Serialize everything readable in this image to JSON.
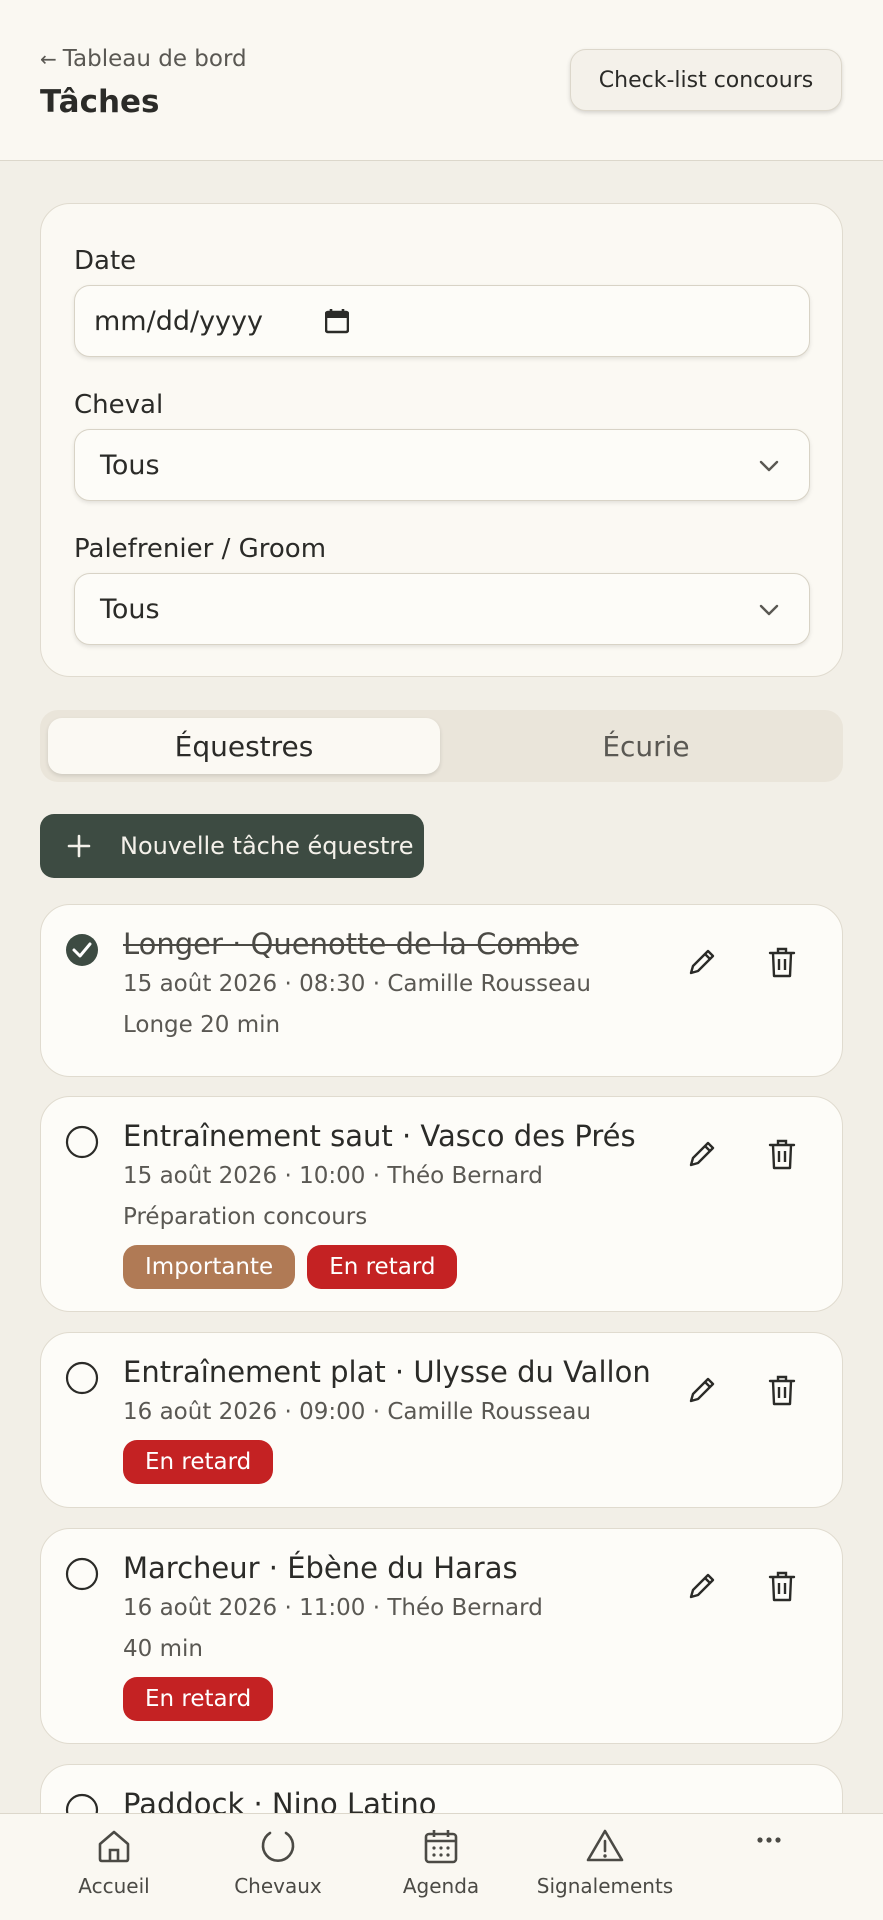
{
  "header": {
    "back_label": "Tableau de bord",
    "title": "Tâches",
    "checklist_button": "Check-list concours"
  },
  "filters": {
    "date_label": "Date",
    "date_value": "mm/dd/yyyy",
    "horse_label": "Cheval",
    "horse_value": "Tous",
    "groom_label": "Palefrenier / Groom",
    "groom_value": "Tous"
  },
  "tabs": {
    "equestrian": "Équestres",
    "stable": "Écurie"
  },
  "new_task_button": "Nouvelle tâche équestre",
  "tasks": [
    {
      "title": "Longer · Quenotte de la Combe",
      "meta": "15 août 2026 · 08:30 · Camille Rousseau",
      "note": "Longe 20 min",
      "done": true
    },
    {
      "title": "Entraînement saut · Vasco des Prés",
      "meta": "15 août 2026 · 10:00 · Théo Bernard",
      "note": "Préparation concours",
      "badge_important": "Importante",
      "badge_late": "En retard",
      "done": false
    },
    {
      "title": "Entraînement plat · Ulysse du Vallon",
      "meta": "16 août 2026 · 09:00 · Camille Rousseau",
      "badge_late": "En retard",
      "done": false
    },
    {
      "title": "Marcheur · Ébène du Haras",
      "meta": "16 août 2026 · 11:00 · Théo Bernard",
      "note": "40 min",
      "badge_late": "En retard",
      "done": false
    },
    {
      "title": "Paddock · Nino Latino",
      "done": false
    }
  ],
  "nav": {
    "home": "Accueil",
    "horses": "Chevaux",
    "agenda": "Agenda",
    "reports": "Signalements"
  },
  "colors": {
    "accent_dark": "#3d4b42",
    "late": "#c42223",
    "important": "#b07a55",
    "background": "#f2efe7"
  }
}
